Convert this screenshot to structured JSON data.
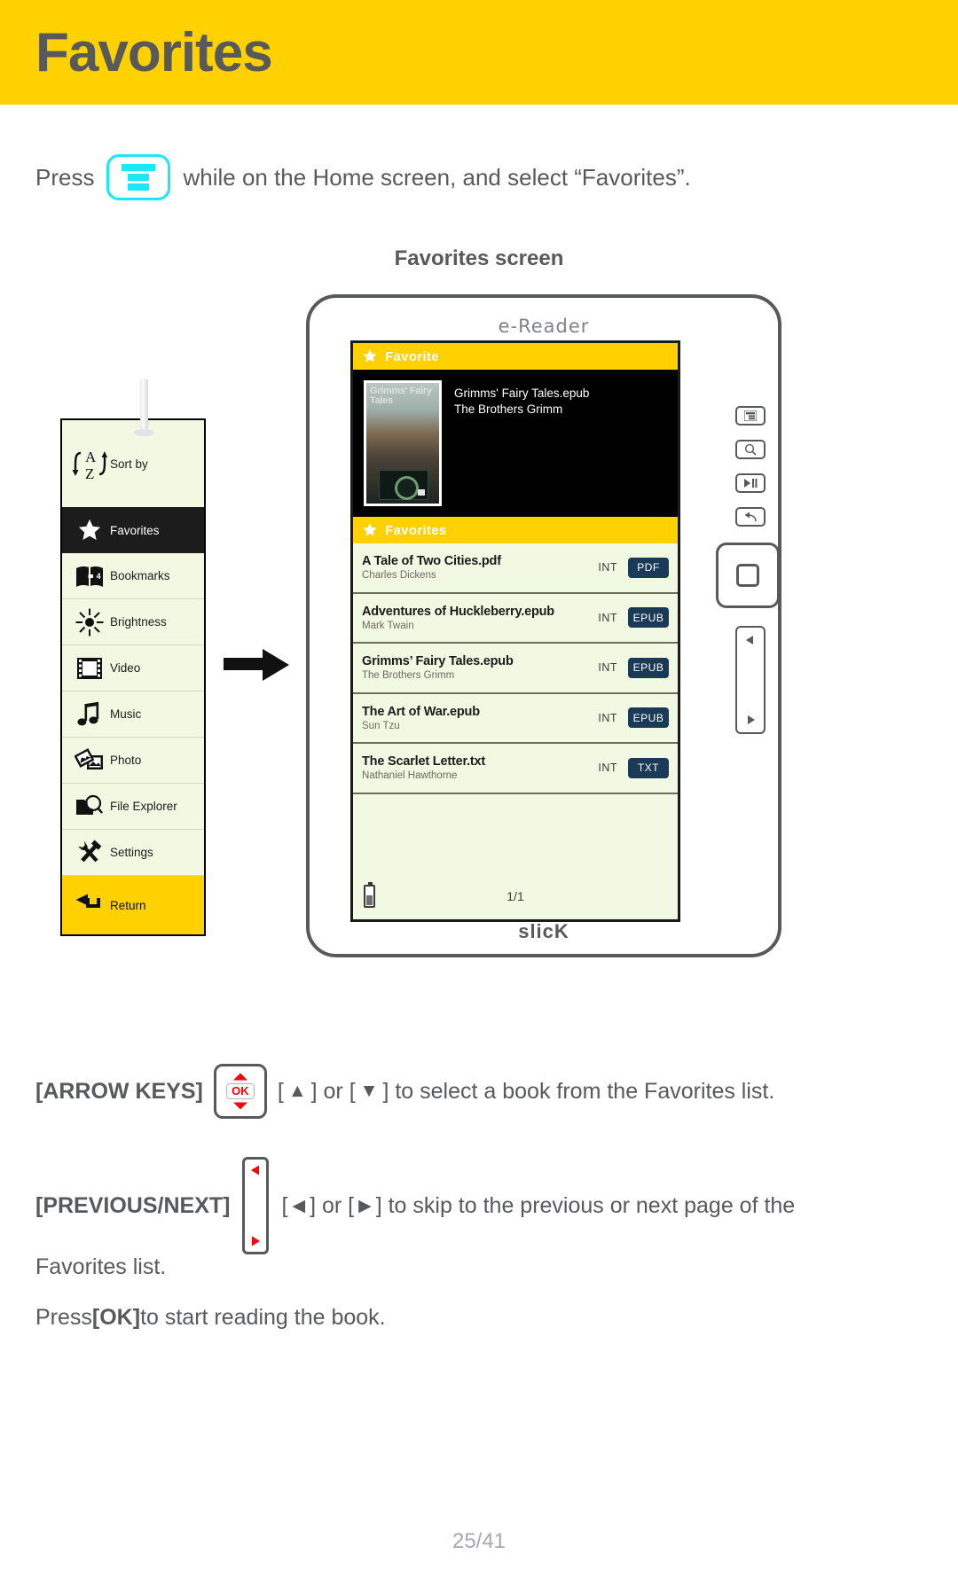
{
  "header": {
    "title": "Favorites"
  },
  "intro": {
    "before": "Press",
    "after": "while on the Home screen, and select “Favorites”.",
    "key_icon": "menu-key-icon"
  },
  "screen_caption": "Favorites screen",
  "sidebar": {
    "items": [
      {
        "label": "Sort by",
        "icon": "sort-az-icon",
        "state": "normal"
      },
      {
        "label": "Favorites",
        "icon": "star-icon",
        "state": "selected"
      },
      {
        "label": "Bookmarks",
        "icon": "bookmark-book-icon",
        "state": "normal"
      },
      {
        "label": "Brightness",
        "icon": "sun-icon",
        "state": "normal"
      },
      {
        "label": "Video",
        "icon": "film-icon",
        "state": "normal"
      },
      {
        "label": "Music",
        "icon": "music-note-icon",
        "state": "normal"
      },
      {
        "label": "Photo",
        "icon": "photos-icon",
        "state": "normal"
      },
      {
        "label": "File Explorer",
        "icon": "folder-search-icon",
        "state": "normal"
      },
      {
        "label": "Settings",
        "icon": "tools-icon",
        "state": "normal"
      },
      {
        "label": "Return",
        "icon": "return-arrow-icon",
        "state": "return"
      }
    ],
    "sort_letters": {
      "top": "A",
      "bottom": "Z"
    },
    "bookmark_count": "4"
  },
  "device": {
    "brand_top": "e-Reader",
    "brand_bottom": "slicK",
    "side_buttons": [
      "menu-icon",
      "zoom-icon",
      "play-pause-icon",
      "back-icon"
    ],
    "home_button": "home-square-icon",
    "prev_next_button": {
      "prev": "◀",
      "next": "▶"
    }
  },
  "screen": {
    "top_bar": {
      "label": "Favorite",
      "icon": "star-icon"
    },
    "preview": {
      "cover_title": "Grimms' Fairy Tales",
      "title": "Grimms' Fairy Tales.epub",
      "author": "The Brothers Grimm"
    },
    "list_bar": {
      "label": "Favorites",
      "icon": "star-icon"
    },
    "books": [
      {
        "title": "A Tale of Two Cities.pdf",
        "author": "Charles Dickens",
        "location": "INT",
        "format": "PDF"
      },
      {
        "title": "Adventures of Huckleberry.epub",
        "author": "Mark Twain",
        "location": "INT",
        "format": "EPUB"
      },
      {
        "title": "Grimms’ Fairy Tales.epub",
        "author": "The Brothers Grimm",
        "location": "INT",
        "format": "EPUB"
      },
      {
        "title": "The Art of War.epub",
        "author": "Sun Tzu",
        "location": "INT",
        "format": "EPUB"
      },
      {
        "title": "The Scarlet Letter.txt",
        "author": "Nathaniel Hawthorne",
        "location": "INT",
        "format": "TXT"
      }
    ],
    "page_indicator": "1/1",
    "battery_icon": "battery-icon"
  },
  "instructions": {
    "arrow_keys": {
      "label": "[ARROW KEYS]",
      "key_ok": "OK",
      "text_1": "[",
      "up": "▲",
      "text_2": "] or [",
      "down": "▼",
      "text_3": "] to select a book from the Favorites list."
    },
    "prev_next": {
      "label": "[PREVIOUS/NEXT]",
      "text_1": "[",
      "prev": "◀",
      "text_2": "] or [",
      "next": "▶",
      "text_3": "] to skip to the previous or next page of the",
      "text_4": "Favorites list."
    },
    "ok_line": {
      "before": "Press ",
      "bold": "[OK]",
      "after": " to start reading the book."
    }
  },
  "footer": {
    "page": "25/41"
  },
  "colors": {
    "brand_yellow": "#ffd100",
    "accent_cyan": "#19e8f5",
    "screen_bg": "#f2f9e2",
    "badge_navy": "#1b3a57",
    "text_gray": "#58595b",
    "ok_red": "#ff0000"
  }
}
